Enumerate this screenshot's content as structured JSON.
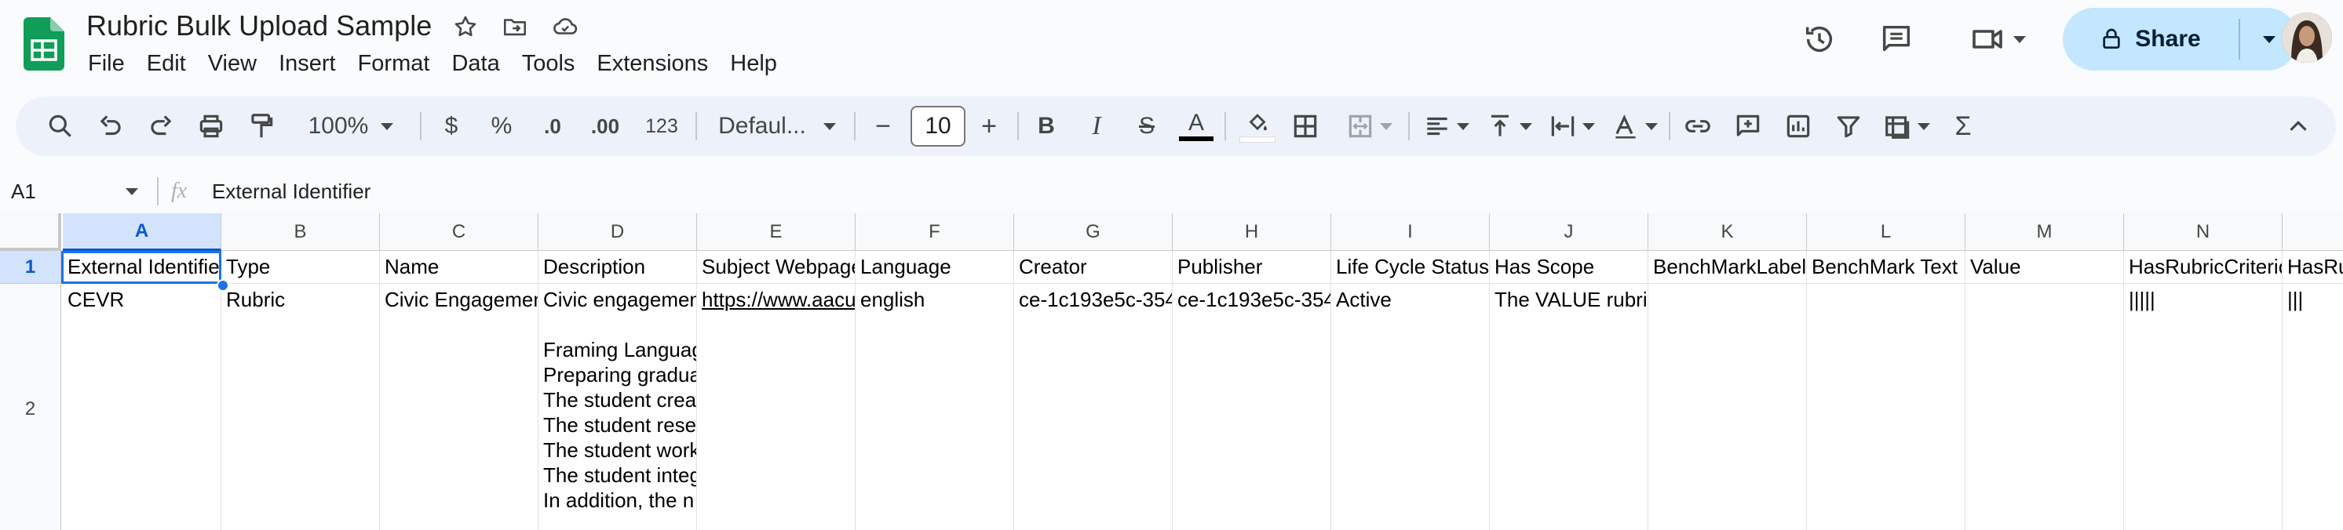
{
  "document": {
    "title": "Rubric Bulk Upload Sample",
    "icons": [
      "star-icon",
      "move-to-folder-icon",
      "cloud-saved-icon"
    ]
  },
  "menu": [
    "File",
    "Edit",
    "View",
    "Insert",
    "Format",
    "Data",
    "Tools",
    "Extensions",
    "Help"
  ],
  "header_actions": {
    "share_label": "Share",
    "icons": [
      "version-history-icon",
      "comments-icon",
      "meet-icon",
      "lock-icon",
      "avatar"
    ]
  },
  "toolbar": {
    "zoom": "100%",
    "currency": "$",
    "percent": "%",
    "decrease_decimal": ".0",
    "increase_decimal": ".00",
    "number_format": "123",
    "font": "Defaul...",
    "font_size": "10",
    "minus": "−",
    "plus": "+",
    "bold": "B",
    "italic": "I",
    "strike": "S",
    "text_color": "A",
    "highlight_color": "#f4b400"
  },
  "formula_bar": {
    "cell_ref": "A1",
    "fx": "fx",
    "value": "External Identifier"
  },
  "grid": {
    "columns": [
      "A",
      "B",
      "C",
      "D",
      "E",
      "F",
      "G",
      "H",
      "I",
      "J",
      "K",
      "L",
      "M",
      "N"
    ],
    "rows": [
      "1",
      "2"
    ],
    "row1": [
      "External Identifier",
      "Type",
      "Name",
      "Description",
      "Subject Webpage",
      "Language",
      "Creator",
      "Publisher",
      "Life Cycle Status",
      "Has Scope",
      "BenchMarkLabel",
      "BenchMark Text",
      "Value",
      "HasRubricCriterion",
      "HasRu"
    ],
    "row2": [
      "CEVR",
      "Rubric",
      "Civic Engagement",
      "Civic engagement\n\nFraming Language\nPreparing graduates\nThe student creates\nThe student researches\nThe student works\nThe student integrates\nIn addition, the n",
      "https://www.aacu",
      "english",
      "ce-1c193e5c-354",
      "ce-1c193e5c-354",
      "Active",
      "The VALUE rubric",
      "",
      "",
      "",
      "|||||",
      "|||"
    ]
  },
  "colors": {
    "accent": "#0b57d0",
    "share_bg": "#c2e7ff",
    "toolbar_bg": "#edf2fa",
    "sheets_green": "#0f9d58"
  }
}
